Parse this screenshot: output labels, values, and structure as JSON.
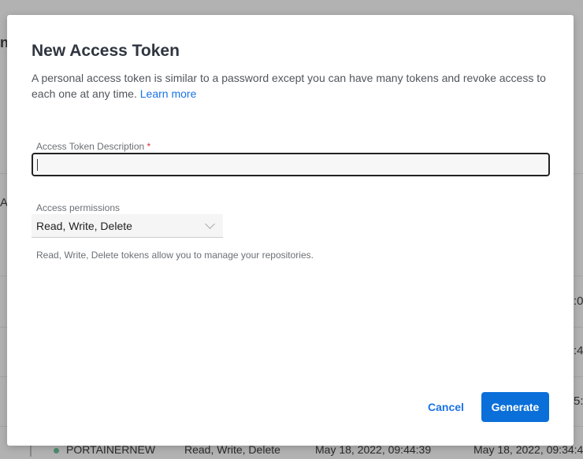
{
  "dialog": {
    "title": "New Access Token",
    "description": "A personal access token is similar to a password except you can have many tokens and revoke access to each one at any time.",
    "learn_more": "Learn more",
    "description_field": {
      "label": "Access Token Description",
      "required_mark": "*",
      "value": ""
    },
    "permissions_field": {
      "label": "Access permissions",
      "selected": "Read, Write, Delete"
    },
    "permissions_help": "Read, Write, Delete tokens allow you to manage your repositories.",
    "cancel_label": "Cancel",
    "generate_label": "Generate"
  },
  "background": {
    "fragments": [
      "n",
      "A",
      ":0",
      ":4",
      "5:1"
    ],
    "row": {
      "name": "PORTAINERNEW",
      "permissions": "Read, Write, Delete",
      "created": "May 18, 2022, 09:44:39",
      "last_used": "May 18, 2022, 09:34:4"
    }
  }
}
